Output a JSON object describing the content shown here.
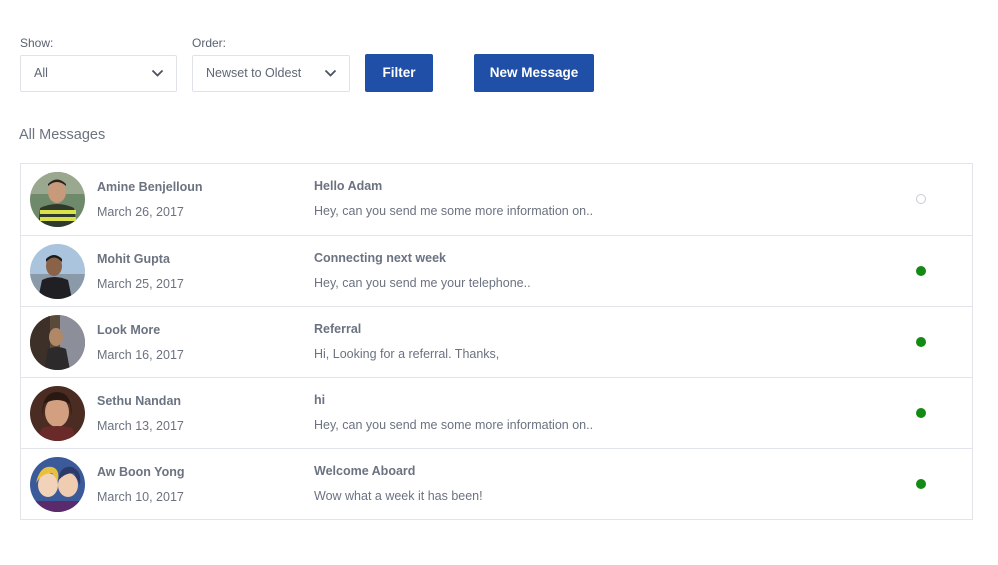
{
  "filters": {
    "show_label": "Show:",
    "show_value": "All",
    "order_label": "Order:",
    "order_value": "Newset to Oldest",
    "filter_button": "Filter",
    "new_message_button": "New Message"
  },
  "section_title": "All Messages",
  "messages": [
    {
      "name": "Amine Benjelloun",
      "date": "March 26, 2017",
      "subject": "Hello Adam",
      "preview": "Hey, can you send me some more information on..",
      "status": "read"
    },
    {
      "name": "Mohit Gupta",
      "date": "March 25, 2017",
      "subject": "Connecting next week",
      "preview": "Hey, can you send me your telephone..",
      "status": "unread"
    },
    {
      "name": "Look More",
      "date": "March 16, 2017",
      "subject": "Referral",
      "preview": "Hi, Looking for a referral. Thanks,",
      "status": "unread"
    },
    {
      "name": "Sethu Nandan",
      "date": "March 13, 2017",
      "subject": "hi",
      "preview": "Hey, can you send me some more information on..",
      "status": "unread"
    },
    {
      "name": "Aw Boon Yong",
      "date": "March 10, 2017",
      "subject": "Welcome Aboard",
      "preview": "Wow what a week it has been!",
      "status": "unread"
    }
  ],
  "colors": {
    "primary": "#1f4fa7",
    "unread_dot": "#138a13",
    "read_dot_border": "#c7cbd1"
  }
}
